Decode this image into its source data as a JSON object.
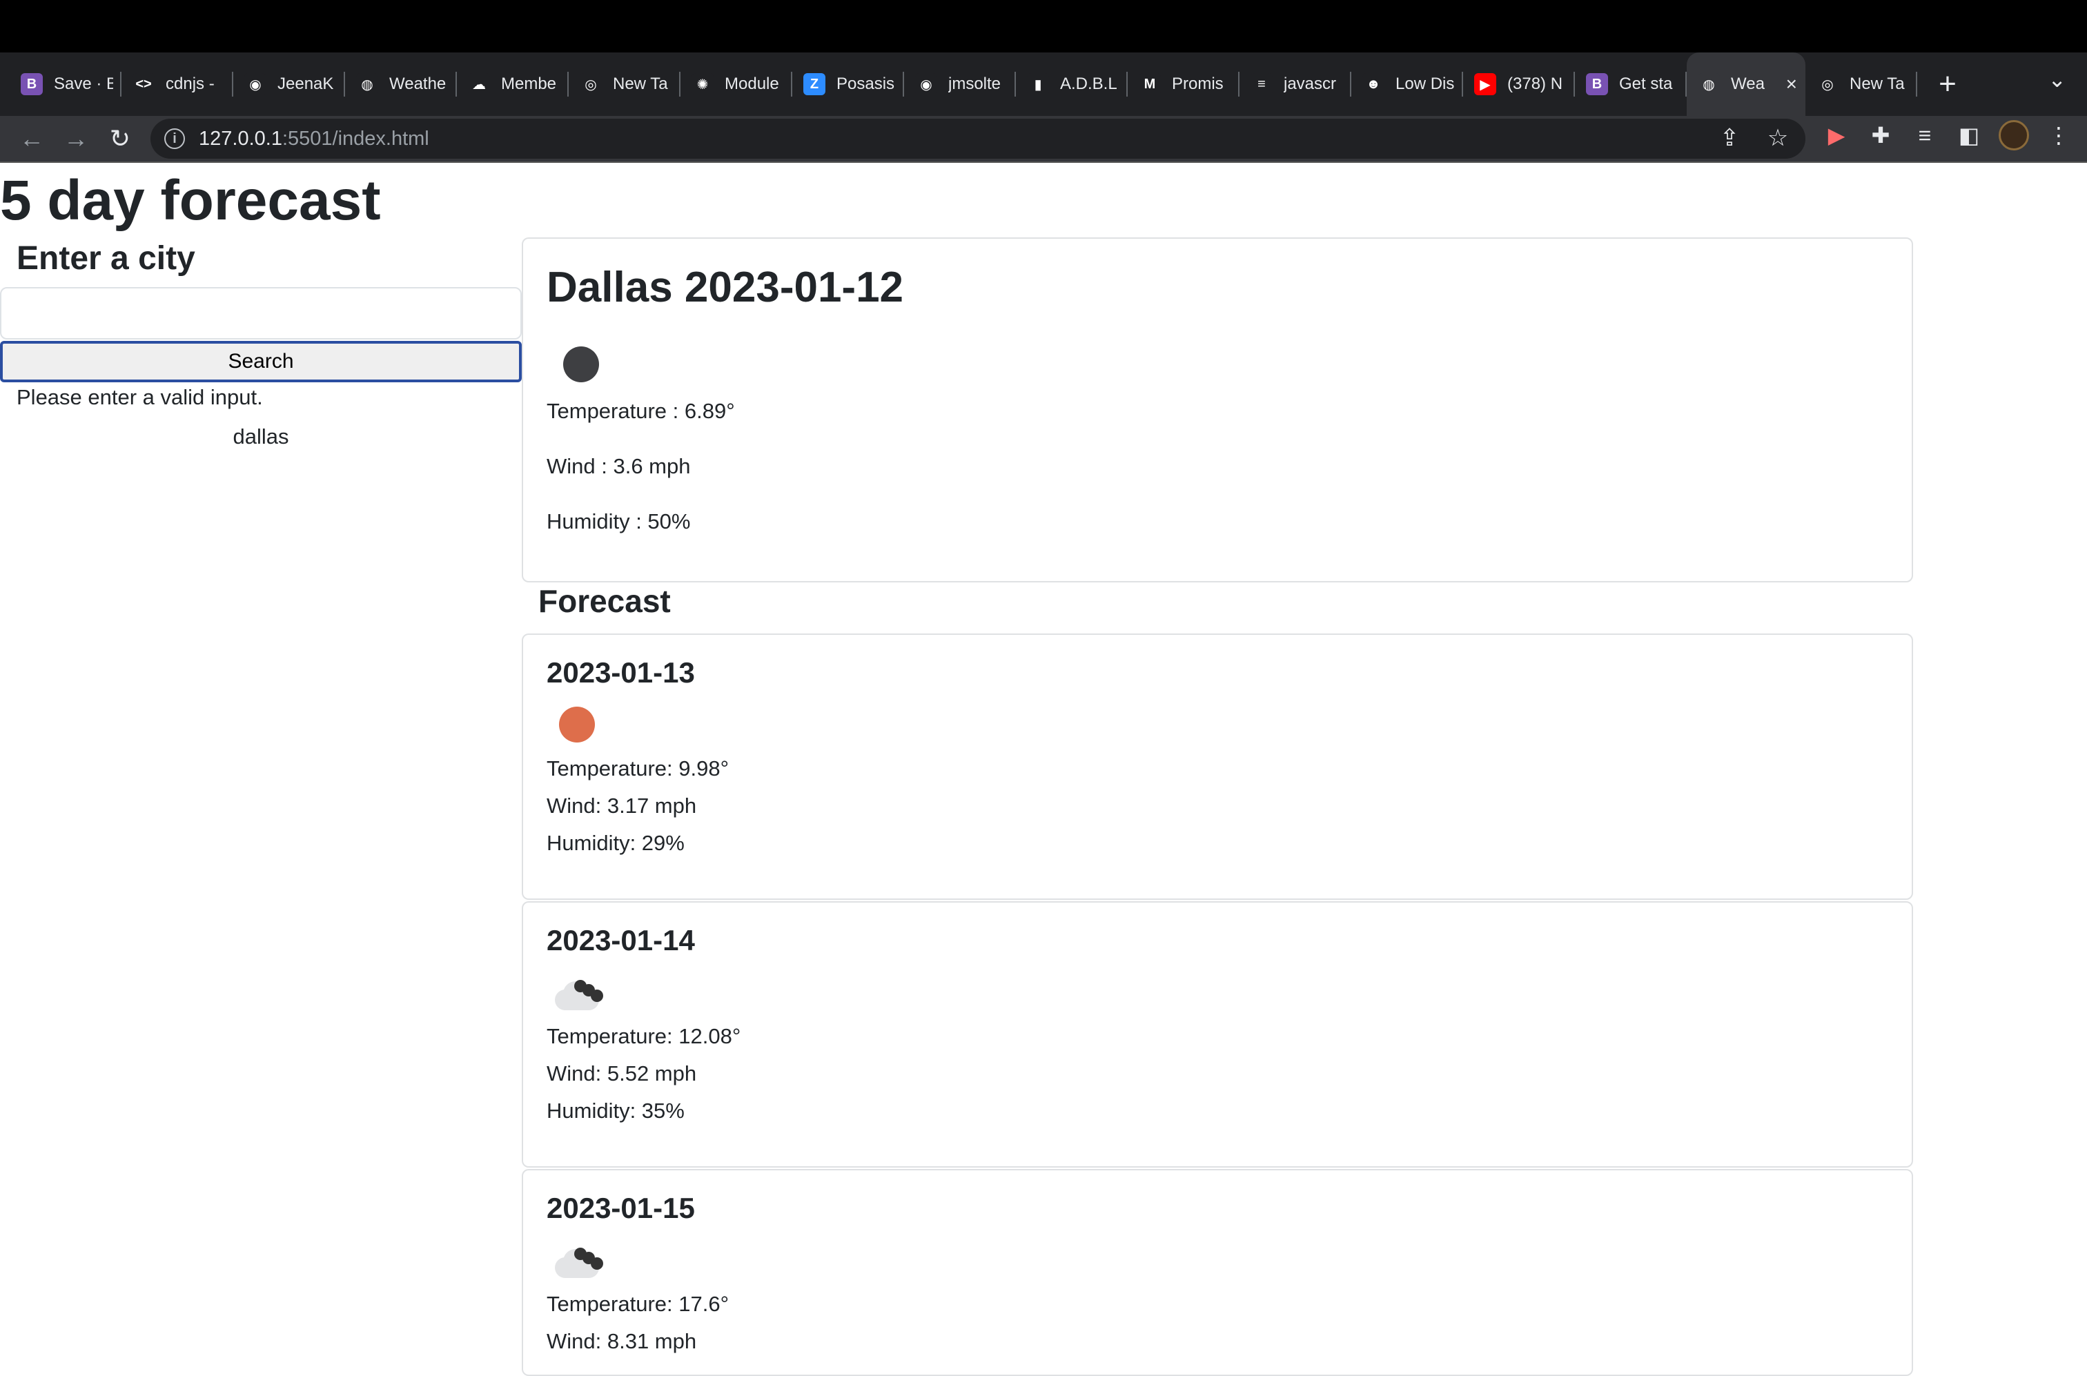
{
  "browser": {
    "tabs": [
      {
        "title": "Save · B",
        "favicon": "bootstrap-icon",
        "color": "#7952b3",
        "glyph": "B"
      },
      {
        "title": "cdnjs - ",
        "favicon": "code-icon",
        "color": "#202124",
        "glyph": "<>"
      },
      {
        "title": "JeenaK",
        "favicon": "github-icon",
        "color": "#202124",
        "glyph": "◉"
      },
      {
        "title": "Weathe",
        "favicon": "globe-icon",
        "color": "#202124",
        "glyph": "◍"
      },
      {
        "title": "Membe",
        "favicon": "cloud-icon",
        "color": "#202124",
        "glyph": "☁"
      },
      {
        "title": "New Ta",
        "favicon": "chrome-icon",
        "color": "#202124",
        "glyph": "◎"
      },
      {
        "title": "Module",
        "favicon": "canvas-icon",
        "color": "#202124",
        "glyph": "✺"
      },
      {
        "title": "Posasis",
        "favicon": "zoom-icon",
        "color": "#2d8cff",
        "glyph": "Z"
      },
      {
        "title": "jmsolte",
        "favicon": "github-icon",
        "color": "#202124",
        "glyph": "◉"
      },
      {
        "title": "A.D.B.L",
        "favicon": "adbl-icon",
        "color": "#202124",
        "glyph": "▮"
      },
      {
        "title": "Promis",
        "favicon": "medium-icon",
        "color": "#202124",
        "glyph": "M"
      },
      {
        "title": "javascr",
        "favicon": "stackoverflow-icon",
        "color": "#202124",
        "glyph": "≡"
      },
      {
        "title": "Low Dis",
        "favicon": "alien-icon",
        "color": "#202124",
        "glyph": "☻"
      },
      {
        "title": "(378) N",
        "favicon": "youtube-icon",
        "color": "#ff0000",
        "glyph": "▶"
      },
      {
        "title": "Get sta",
        "favicon": "bootstrap-icon",
        "color": "#7952b3",
        "glyph": "B"
      },
      {
        "title": "Wea",
        "favicon": "globe-icon",
        "color": "#35363a",
        "glyph": "◍",
        "active": true
      },
      {
        "title": "New Ta",
        "favicon": "chrome-icon",
        "color": "#202124",
        "glyph": "◎"
      }
    ],
    "url_host": "127.0.0.1",
    "url_rest": ":5501/index.html"
  },
  "page": {
    "title": "5 day forecast",
    "sidebar": {
      "heading": "Enter a city",
      "input_value": "",
      "search_label": "Search",
      "error": "Please enter a valid input.",
      "history": [
        "dallas"
      ]
    },
    "current": {
      "city_date": "Dallas 2023-01-12",
      "icon": "dark-dot-icon",
      "temperature": "Temperature : 6.89°",
      "wind": "Wind : 3.6 mph",
      "humidity": "Humidity : 50%"
    },
    "forecast_heading": "Forecast",
    "forecast": [
      {
        "date": "2023-01-13",
        "icon": "orange-dot-icon",
        "temperature": "Temperature: 9.98°",
        "wind": "Wind: 3.17 mph",
        "humidity": "Humidity: 29%"
      },
      {
        "date": "2023-01-14",
        "icon": "cloud-icon",
        "temperature": "Temperature: 12.08°",
        "wind": "Wind: 5.52 mph",
        "humidity": "Humidity: 35%"
      },
      {
        "date": "2023-01-15",
        "icon": "cloud-icon",
        "temperature": "Temperature: 17.6°",
        "wind": "Wind: 8.31 mph",
        "humidity": ""
      }
    ]
  }
}
